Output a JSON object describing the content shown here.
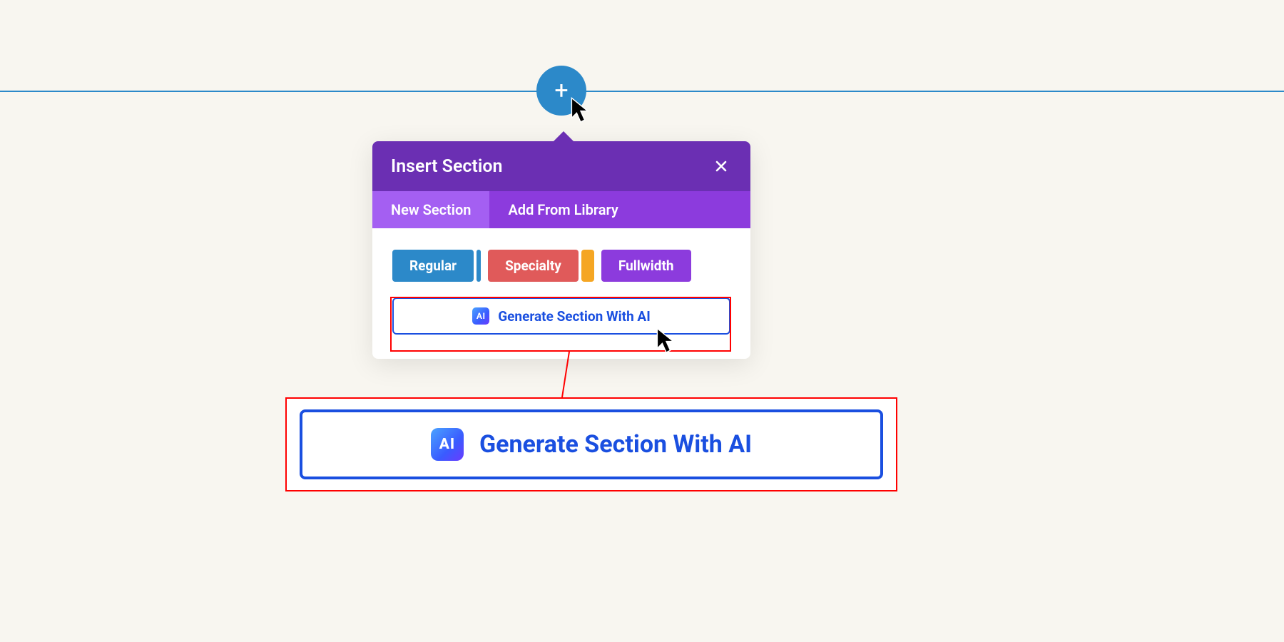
{
  "add_button": {
    "glyph": "+"
  },
  "popover": {
    "title": "Insert Section",
    "tabs": {
      "new_section": "New Section",
      "add_from_library": "Add From Library"
    },
    "types": {
      "regular": "Regular",
      "specialty": "Specialty",
      "fullwidth": "Fullwidth"
    },
    "ai_button": {
      "badge": "AI",
      "label": "Generate Section With AI"
    }
  },
  "zoom": {
    "ai_button": {
      "badge": "AI",
      "label": "Generate Section With AI"
    }
  },
  "colors": {
    "blue": "#2c89c9",
    "purple_dark": "#6b2fb3",
    "purple": "#8c3bdd",
    "purple_light": "#a45ff2",
    "red_btn": "#e05a5a",
    "orange": "#f5a623",
    "link_blue": "#1a4fe0",
    "annotation_red": "#ff0000"
  }
}
